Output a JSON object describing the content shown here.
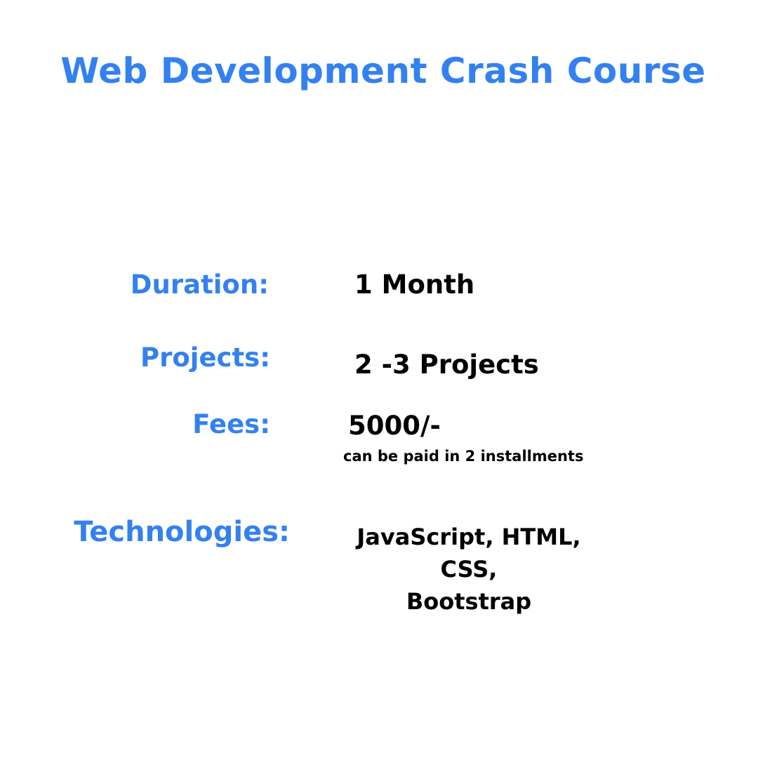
{
  "title": "Web Development Crash Course",
  "details": {
    "duration": {
      "label": "Duration:",
      "value": "1 Month"
    },
    "projects": {
      "label": "Projects:",
      "value": "2 -3 Projects"
    },
    "fees": {
      "label": "Fees:",
      "value": "5000/-",
      "note": "can be paid in 2 installments"
    },
    "technologies": {
      "label": "Technologies:",
      "line1": "JavaScript, HTML, CSS,",
      "line2": "Bootstrap"
    }
  },
  "colors": {
    "accent": "#3381f0",
    "text": "#000000",
    "background": "#ffffff"
  }
}
